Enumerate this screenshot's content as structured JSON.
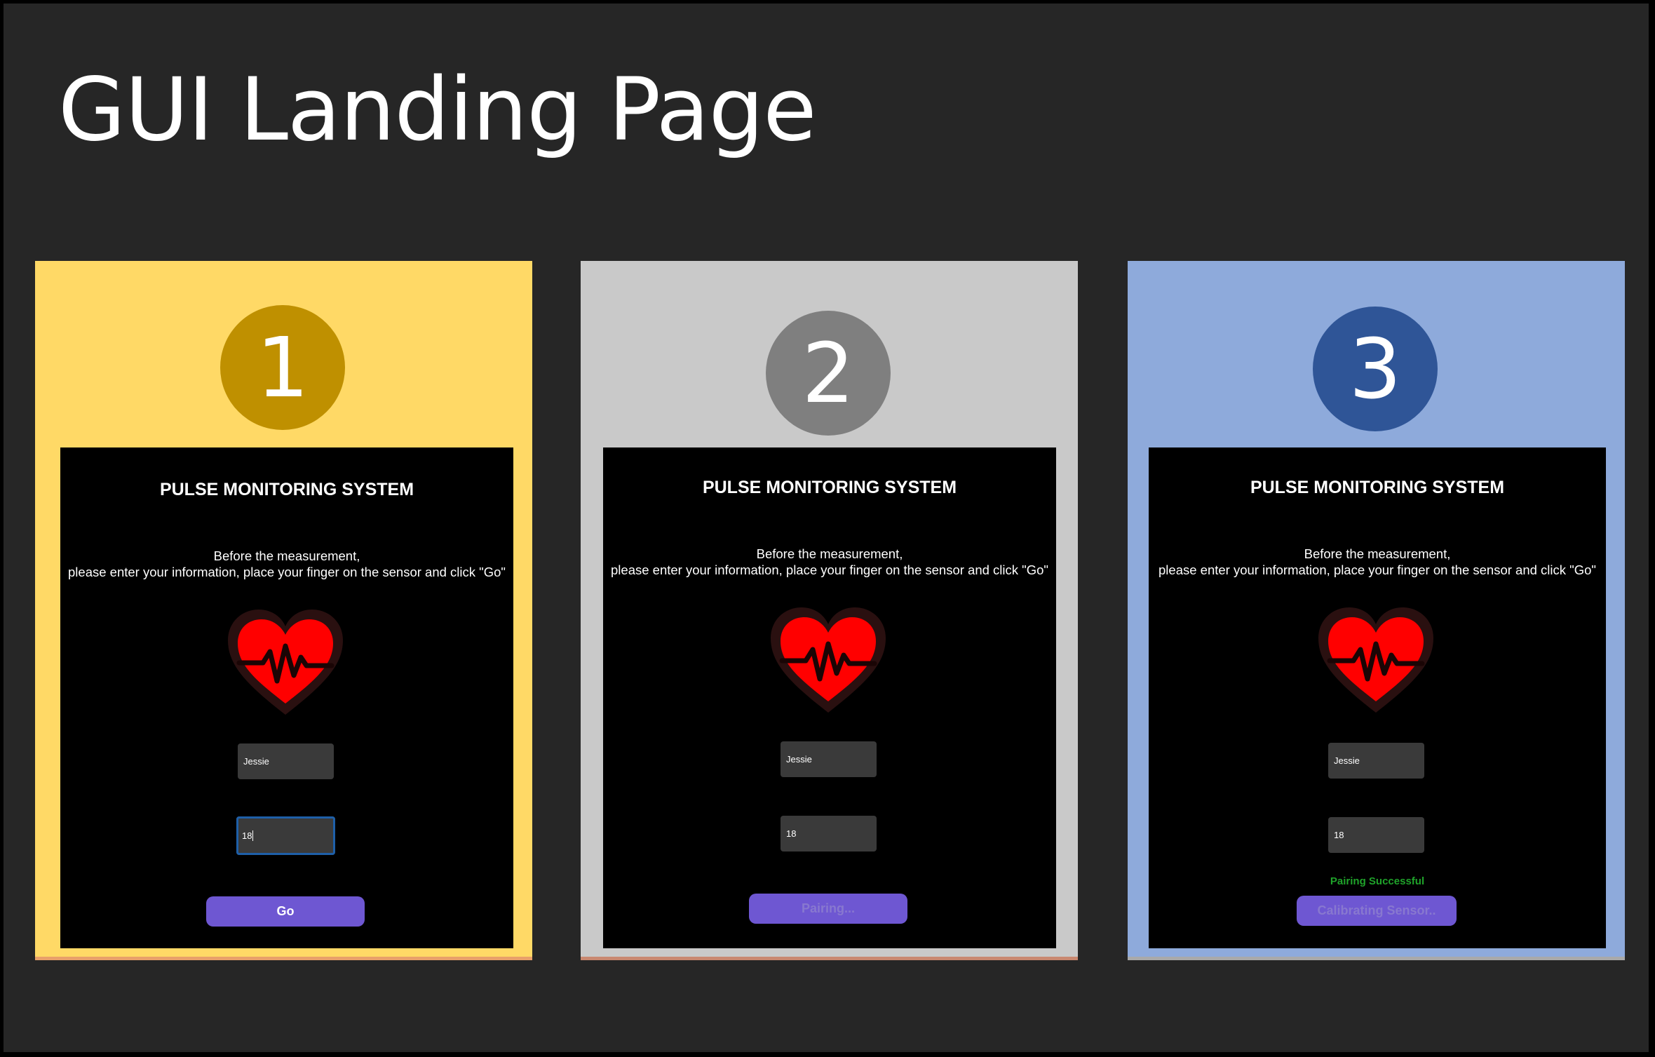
{
  "page": {
    "title": "GUI Landing Page",
    "background": "#262626"
  },
  "app": {
    "title": "PULSE MONITORING SYSTEM",
    "instruction_line1": "Before the measurement,",
    "instruction_line2": "please enter your information, place your finger on the sensor and click \"Go\"",
    "heart_icon": "heart-pulse-icon"
  },
  "panels": [
    {
      "step": "1",
      "panel_color": "#ffd966",
      "circle_color": "#bf9000",
      "name_value": "Jessie",
      "age_value": "18",
      "age_focused": true,
      "status": "",
      "button_label": "Go",
      "button_disabled": false
    },
    {
      "step": "2",
      "panel_color": "#c9c9c9",
      "circle_color": "#7f7f7f",
      "name_value": "Jessie",
      "age_value": "18",
      "age_focused": false,
      "status": "",
      "button_label": "Pairing...",
      "button_disabled": true
    },
    {
      "step": "3",
      "panel_color": "#8eaadb",
      "circle_color": "#2f5597",
      "name_value": "Jessie",
      "age_value": "18",
      "age_focused": false,
      "status": "Pairing Successful",
      "button_label": "Calibrating Sensor..",
      "button_disabled": true
    }
  ]
}
